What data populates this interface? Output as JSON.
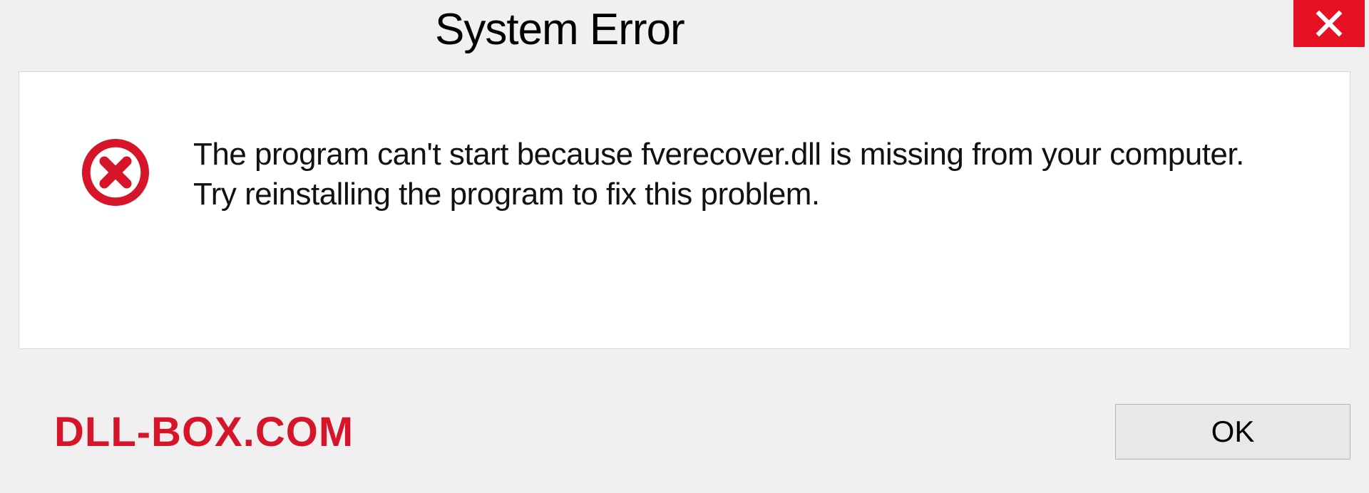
{
  "dialog": {
    "title": "System Error",
    "message": "The program can't start because fverecover.dll is missing from your computer. Try reinstalling the program to fix this problem.",
    "watermark": "DLL-BOX.COM",
    "ok_label": "OK"
  },
  "icons": {
    "close": "close-icon",
    "error": "error-circle-x-icon"
  },
  "colors": {
    "close_bg": "#e81123",
    "error_red": "#d7152a",
    "panel_bg": "#ffffff",
    "window_bg": "#f0f0f0"
  }
}
